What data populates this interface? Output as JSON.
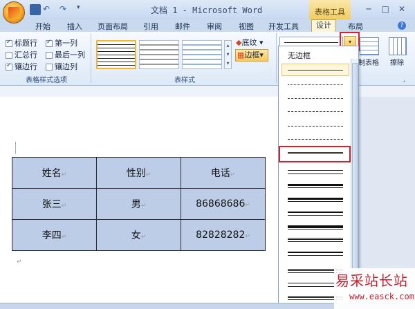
{
  "window": {
    "title": "文档 1 - Microsoft Word",
    "tools_label": "表格工具",
    "controls": [
      "─",
      "□",
      "✕"
    ]
  },
  "tabs": [
    "开始",
    "插入",
    "页面布局",
    "引用",
    "邮件",
    "审阅",
    "视图",
    "开发工具",
    "设计",
    "布局"
  ],
  "active_tab": "设计",
  "style_options": {
    "items": [
      {
        "label": "标题行",
        "checked": true
      },
      {
        "label": "第一列",
        "checked": true
      },
      {
        "label": "汇总行",
        "checked": false
      },
      {
        "label": "最后一列",
        "checked": false
      },
      {
        "label": "镶边行",
        "checked": true
      },
      {
        "label": "镶边列",
        "checked": false
      }
    ],
    "group_label": "表格样式选项"
  },
  "table_styles": {
    "group_label": "表样式",
    "shading_label": "底纹",
    "borders_label": "边框"
  },
  "draw": {
    "draw_table_label": "制表格",
    "eraser_label": "擦除"
  },
  "border_dropdown": {
    "no_border_label": "无边框",
    "selected_index": 7
  },
  "table": {
    "rows": [
      [
        "姓名",
        "性别",
        "电话"
      ],
      [
        "张三",
        "男",
        "86868686"
      ],
      [
        "李四",
        "女",
        "82828282"
      ]
    ]
  },
  "watermark": {
    "line1": "易采站长站",
    "line2": "www.easck.com"
  },
  "colors": {
    "highlight": "#d0232a",
    "table_fill": "#bdcde7",
    "ribbon": "#dde9f7"
  }
}
